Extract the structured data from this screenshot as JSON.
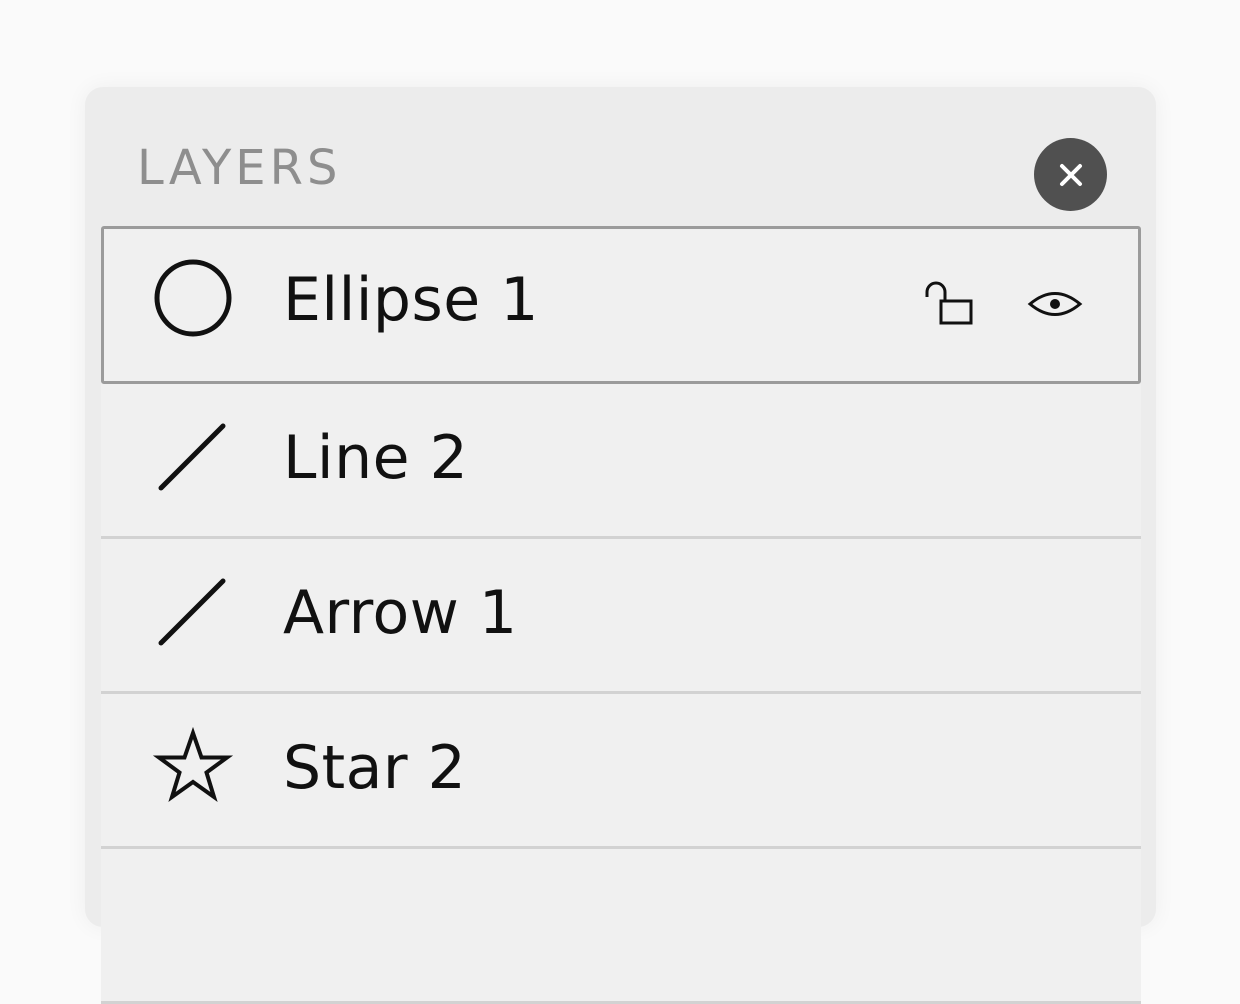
{
  "panel": {
    "title": "LAYERS",
    "close_icon": "close-icon"
  },
  "layers": [
    {
      "label": "Ellipse 1",
      "icon": "ellipse-icon",
      "selected": true,
      "actions": [
        "unlock-icon",
        "eye-icon"
      ]
    },
    {
      "label": "Line 2",
      "icon": "line-icon",
      "selected": false
    },
    {
      "label": "Arrow 1",
      "icon": "line-icon",
      "selected": false
    },
    {
      "label": "Star 2",
      "icon": "star-icon",
      "selected": false
    },
    {
      "label": "",
      "icon": "",
      "selected": false
    }
  ],
  "colors": {
    "panel_bg": "#ececec",
    "row_bg": "#f0f0f0",
    "title": "#8e8e8e",
    "close_bg": "#505050",
    "selected_border": "#9b9b9b"
  }
}
